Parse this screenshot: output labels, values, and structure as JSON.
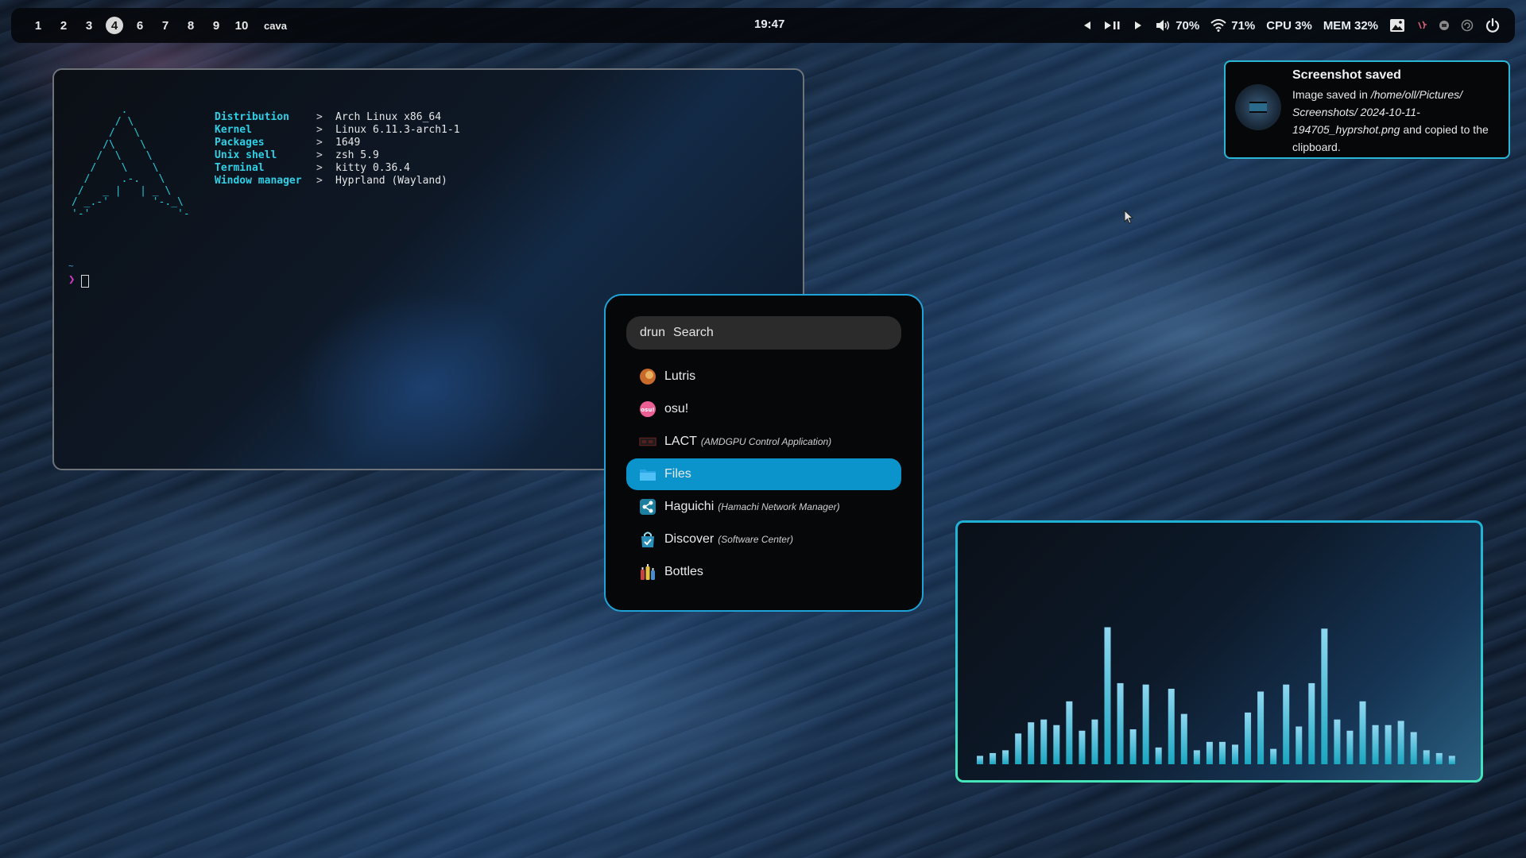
{
  "topbar": {
    "workspaces": [
      {
        "label": "1",
        "active": false
      },
      {
        "label": "2",
        "active": false
      },
      {
        "label": "3",
        "active": false
      },
      {
        "label": "4",
        "active": true
      },
      {
        "label": "6",
        "active": false
      },
      {
        "label": "7",
        "active": false
      },
      {
        "label": "8",
        "active": false
      },
      {
        "label": "9",
        "active": false
      },
      {
        "label": "10",
        "active": false
      }
    ],
    "window_title": "cava",
    "clock": "19:47",
    "volume": "70%",
    "wifi": "71%",
    "cpu": "CPU  3%",
    "mem": "MEM 32%"
  },
  "terminal": {
    "info": [
      {
        "key": "Distribution",
        "sep": ">",
        "value": "Arch Linux x86_64"
      },
      {
        "key": "Kernel",
        "sep": ">",
        "value": "Linux 6.11.3-arch1-1"
      },
      {
        "key": "Packages",
        "sep": ">",
        "value": "1649"
      },
      {
        "key": "Unix shell",
        "sep": ">",
        "value": "zsh 5.9"
      },
      {
        "key": "Terminal",
        "sep": ">",
        "value": "kitty 0.36.4"
      },
      {
        "key": "Window manager",
        "sep": ">",
        "value": "Hyprland (Wayland)"
      }
    ],
    "cwd": "~",
    "prompt": "❯"
  },
  "launcher": {
    "mode": "drun",
    "placeholder": "Search",
    "entries": [
      {
        "name": "Lutris",
        "desc": "",
        "icon": "lutris-icon",
        "color": "#c86a2a"
      },
      {
        "name": "osu!",
        "desc": "",
        "icon": "osu-icon",
        "color": "#ec5f94"
      },
      {
        "name": "LACT",
        "desc": "(AMDGPU Control Application)",
        "icon": "gpu-card-icon",
        "color": "#5a2020"
      },
      {
        "name": "Files",
        "desc": "",
        "icon": "folder-icon",
        "color": "#2aa6e8",
        "selected": true
      },
      {
        "name": "Haguichi",
        "desc": "(Hamachi Network Manager)",
        "icon": "network-icon",
        "color": "#1d7fa0"
      },
      {
        "name": "Discover",
        "desc": "(Software Center)",
        "icon": "store-bag-icon",
        "color": "#2a8fb8"
      },
      {
        "name": "Bottles",
        "desc": "",
        "icon": "bottles-icon",
        "color": "#c84040"
      }
    ]
  },
  "notification": {
    "title": "Screenshot saved",
    "body_prefix": "Image saved in",
    "path": "/home/oll/Pictures/ Screenshots/ 2024-10-11-194705_hyprshot.png",
    "body_suffix": "and copied to the clipboard."
  },
  "cava": {
    "colors": {
      "low": "#1aa6c0",
      "high": "#8fd6f0"
    },
    "levels": [
      0.06,
      0.08,
      0.1,
      0.22,
      0.3,
      0.32,
      0.28,
      0.45,
      0.24,
      0.32,
      0.98,
      0.58,
      0.25,
      0.57,
      0.12,
      0.54,
      0.36,
      0.1,
      0.16,
      0.16,
      0.14,
      0.37,
      0.52,
      0.11,
      0.57,
      0.27,
      0.58,
      0.97,
      0.32,
      0.24,
      0.45,
      0.28,
      0.28,
      0.31,
      0.23,
      0.1,
      0.08,
      0.06
    ]
  },
  "accent": "#1ea3d8"
}
